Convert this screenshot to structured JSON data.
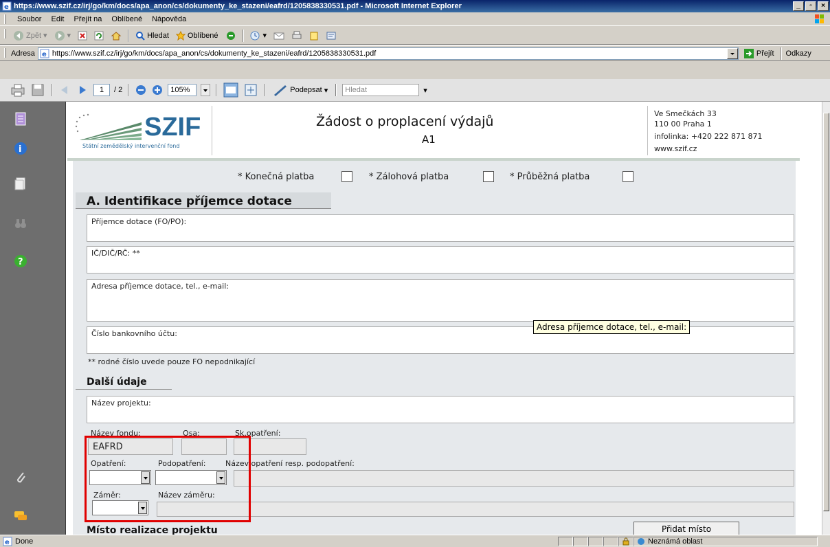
{
  "window": {
    "title": "https://www.szif.cz/irj/go/km/docs/apa_anon/cs/dokumenty_ke_stazeni/eafrd/1205838330531.pdf - Microsoft Internet Explorer"
  },
  "menu": [
    "Soubor",
    "Edit",
    "Přejít na",
    "Oblíbené",
    "Nápověda"
  ],
  "toolbar": {
    "back": "Zpět",
    "search": "Hledat",
    "favorites": "Oblíbené"
  },
  "address": {
    "label": "Adresa",
    "url": "https://www.szif.cz/irj/go/km/docs/apa_anon/cs/dokumenty_ke_stazeni/eafrd/1205838330531.pdf",
    "go": "Přejít",
    "links": "Odkazy"
  },
  "acrobat": {
    "page": "1",
    "page_total": "/ 2",
    "zoom": "105%",
    "sign": "Podepsat",
    "search_placeholder": "Hledat"
  },
  "doc": {
    "logo_text": "SZIF",
    "logo_sub": "Státní zemědělský intervenční fond",
    "title": "Žádost o proplacení výdajů",
    "subtitle": "A1",
    "contact": [
      "Ve Smečkách 33",
      "110 00 Praha 1",
      "infolinka: +420 222 871 871",
      "www.szif.cz"
    ],
    "payments": [
      "* Konečná platba",
      "* Zálohová platba",
      "* Průběžná platba"
    ],
    "section_a": "A. Identifikace příjemce dotace",
    "fields": {
      "recipient": "Příjemce dotace (FO/PO):",
      "ico": "IČ/DIČ/RČ:  **",
      "address": "Adresa příjemce dotace, tel., e-mail:",
      "bank": "Číslo bankovního účtu:"
    },
    "footnote": "** rodné číslo uvede pouze FO nepodnikající",
    "tooltip": "Adresa příjemce dotace, tel., e-mail:",
    "section_other": "Další údaje",
    "project_name": "Název projektu:",
    "fund_label": "Název fondu:",
    "fund_value": "EAFRD",
    "axis_label": "Osa:",
    "sk_label": "Sk.opatření:",
    "measure_label": "Opatření:",
    "submeasure_label": "Podopatření:",
    "measure_name_label": "Název opatření resp. podopatření:",
    "intent_label": "Záměr:",
    "intent_name_label": "Název záměru:",
    "section_place": "Místo realizace projektu",
    "add_place": "Přidat místo"
  },
  "status": {
    "left": "Done",
    "zone": "Neznámá oblast"
  }
}
